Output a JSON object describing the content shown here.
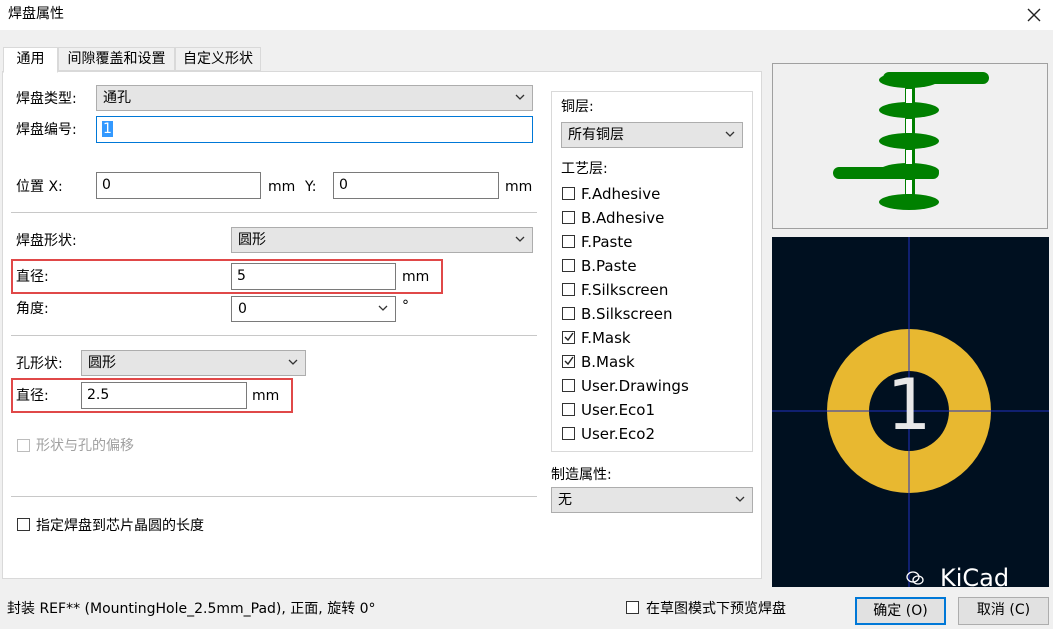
{
  "window": {
    "title": "焊盘属性"
  },
  "tabs": [
    {
      "label": "通用"
    },
    {
      "label": "间隙覆盖和设置"
    },
    {
      "label": "自定义形状"
    }
  ],
  "general": {
    "pad_type_label": "焊盘类型:",
    "pad_type_value": "通孔",
    "pad_number_label": "焊盘编号:",
    "pad_number_value": "1",
    "position_x_label": "位置 X:",
    "position_x_value": "0",
    "position_x_unit": "mm",
    "position_y_label": "Y:",
    "position_y_value": "0",
    "position_y_unit": "mm",
    "pad_shape_label": "焊盘形状:",
    "pad_shape_value": "圆形",
    "diameter_label": "直径:",
    "diameter_value": "5",
    "diameter_unit": "mm",
    "angle_label": "角度:",
    "angle_value": "0",
    "angle_unit": "°",
    "hole_shape_label": "孔形状:",
    "hole_shape_value": "圆形",
    "hole_diameter_label": "直径:",
    "hole_diameter_value": "2.5",
    "hole_diameter_unit": "mm",
    "offset_label": "形状与孔的偏移",
    "die_length_label": "指定焊盘到芯片晶圆的长度"
  },
  "layers": {
    "copper_label": "铜层:",
    "copper_value": "所有铜层",
    "tech_label": "工艺层:",
    "items": [
      {
        "label": "F.Adhesive",
        "checked": false
      },
      {
        "label": "B.Adhesive",
        "checked": false
      },
      {
        "label": "F.Paste",
        "checked": false
      },
      {
        "label": "B.Paste",
        "checked": false
      },
      {
        "label": "F.Silkscreen",
        "checked": false
      },
      {
        "label": "B.Silkscreen",
        "checked": false
      },
      {
        "label": "F.Mask",
        "checked": true
      },
      {
        "label": "B.Mask",
        "checked": true
      },
      {
        "label": "User.Drawings",
        "checked": false
      },
      {
        "label": "User.Eco1",
        "checked": false
      },
      {
        "label": "User.Eco2",
        "checked": false
      }
    ],
    "fab_label": "制造属性:",
    "fab_value": "无"
  },
  "preview": {
    "pad_number": "1",
    "watermark": "KiCad",
    "colors": {
      "pad": "#e8b830",
      "background": "#001020",
      "crosshair": "#2030c0",
      "stack": "#008000"
    }
  },
  "footer": {
    "status": "封装 REF** (MountingHole_2.5mm_Pad), 正面, 旋转 0°",
    "sketch_label": "在草图模式下预览焊盘",
    "ok_label": "确定 (O)",
    "cancel_label": "取消 (C)"
  }
}
